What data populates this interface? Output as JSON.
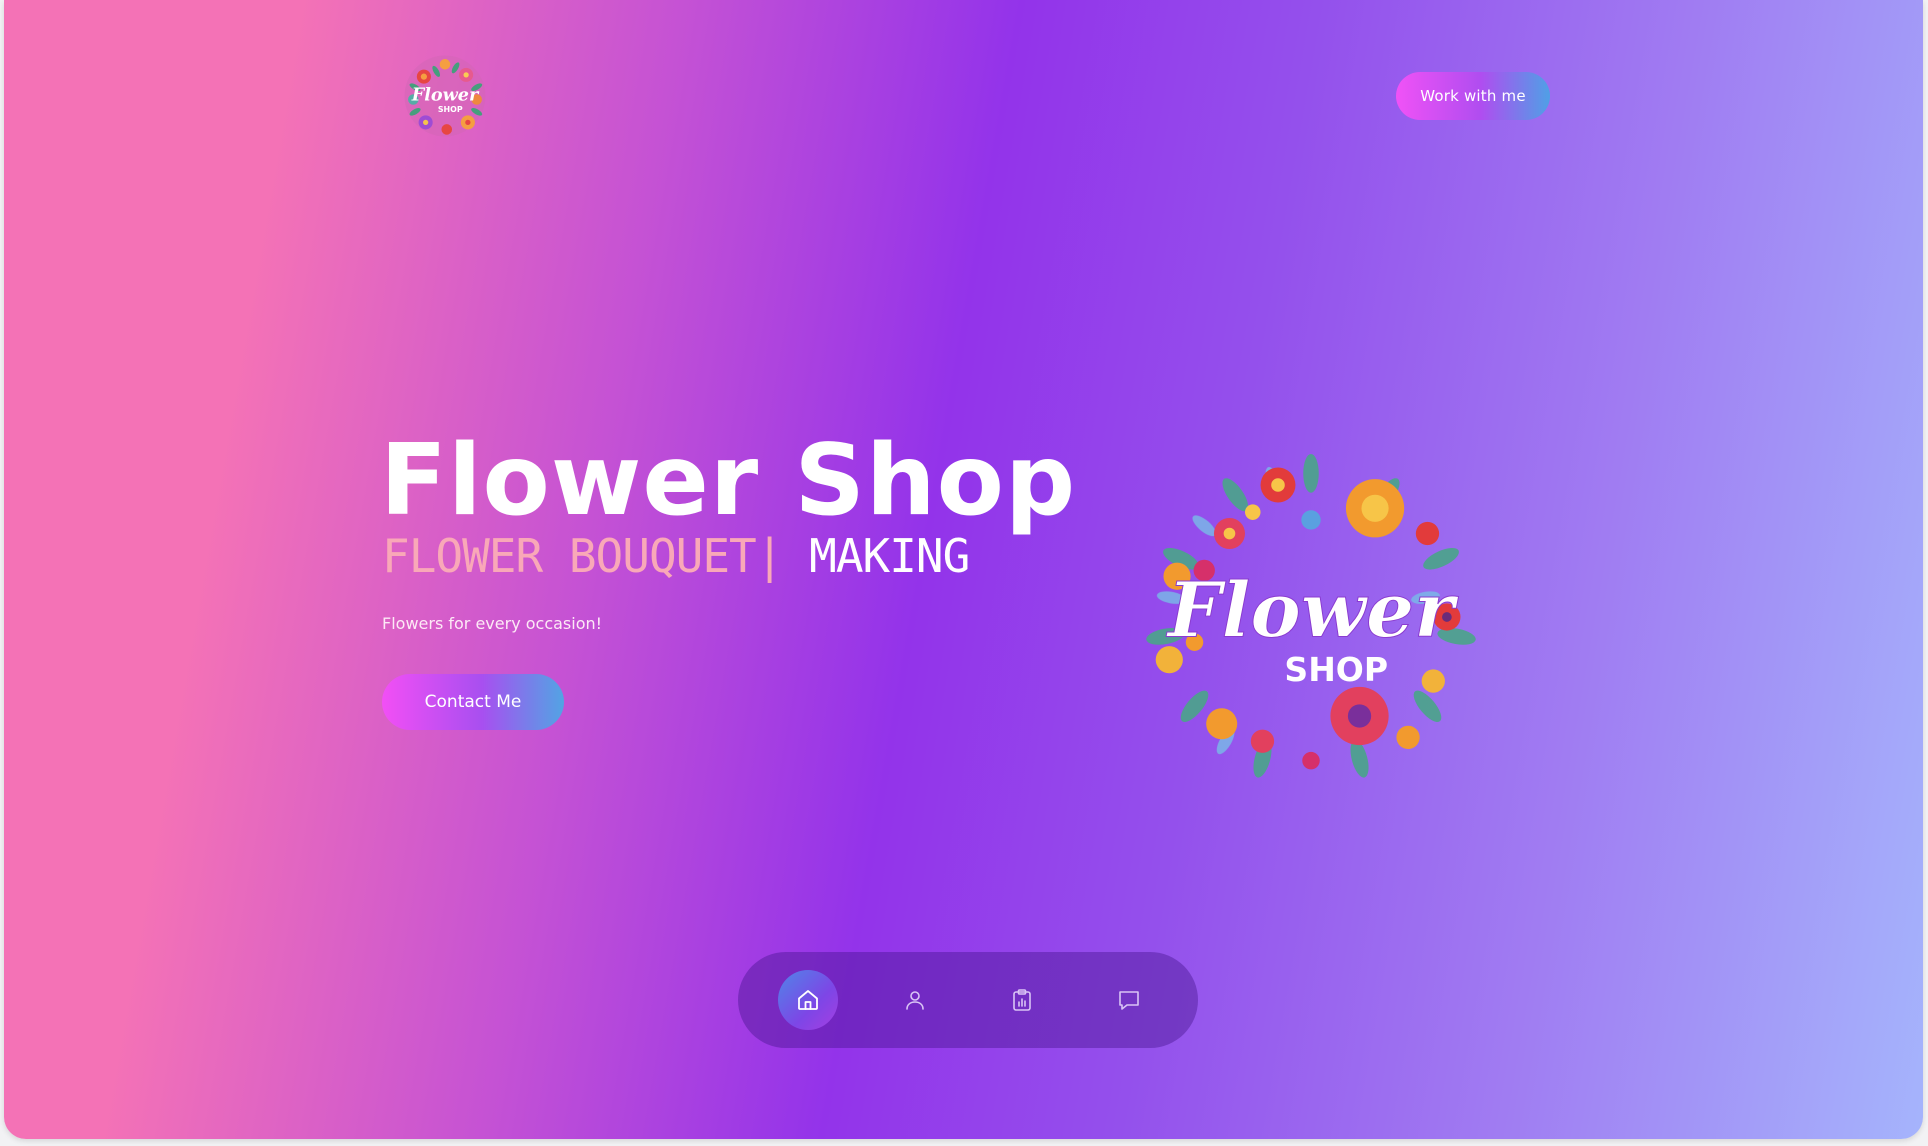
{
  "header": {
    "logo_alt": "Flower Shop logo",
    "logo_text_top": "Flower",
    "logo_text_bottom": "SHOP",
    "work_button_label": "Work with me"
  },
  "hero": {
    "title": "Flower Shop",
    "subtitle_typed": "FLOWER BOUQUET",
    "subtitle_cursor": "|",
    "subtitle_rest": " MAKING",
    "tagline": "Flowers for every occasion!",
    "contact_button_label": "Contact Me",
    "logo_text_top": "Flower",
    "logo_text_bottom": "SHOP"
  },
  "bottom_nav": {
    "items": [
      {
        "icon": "home-icon",
        "active": true
      },
      {
        "icon": "user-icon",
        "active": false
      },
      {
        "icon": "clipboard-chart-icon",
        "active": false
      },
      {
        "icon": "chat-icon",
        "active": false
      }
    ]
  },
  "colors": {
    "gradient_left": "#f472b6",
    "gradient_mid": "#9333ea",
    "gradient_right": "#a5b4fc",
    "subtitle_accent": "#f9a8b8",
    "button_start": "#f24ff5",
    "button_end": "#52a4e4"
  }
}
